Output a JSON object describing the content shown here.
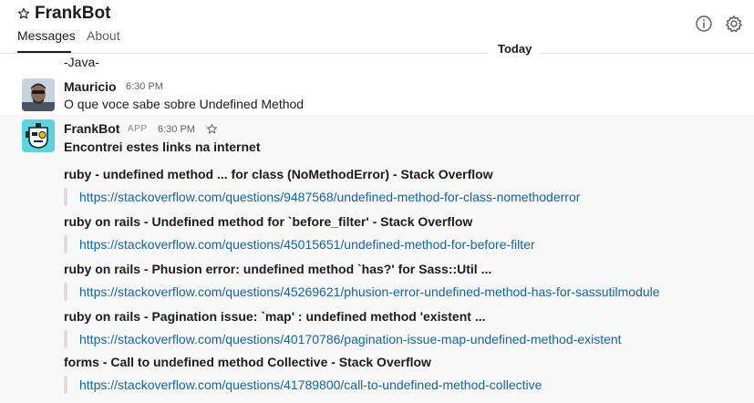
{
  "header": {
    "channel_name": "FrankBot",
    "tabs": [
      {
        "label": "Messages",
        "active": true
      },
      {
        "label": "About",
        "active": false
      }
    ],
    "icons": [
      "star-icon",
      "info-icon",
      "gear-icon"
    ]
  },
  "day_divider": "Today",
  "previous_message_tail": "-Java-",
  "messages": [
    {
      "author": "Mauricio",
      "time": "6:30 PM",
      "text": "O que voce sabe sobre Undefined Method"
    },
    {
      "author": "FrankBot",
      "badge": "APP",
      "time": "6:30 PM",
      "text": "Encontrei estes links na internet",
      "results": [
        {
          "title": "ruby - undefined method ... for class (NoMethodError) - Stack Overflow",
          "url": "https://stackoverflow.com/questions/9487568/undefined-method-for-class-nomethoderror"
        },
        {
          "title": "ruby on rails - Undefined method for `before_filter' - Stack Overflow",
          "url": "https://stackoverflow.com/questions/45015651/undefined-method-for-before-filter"
        },
        {
          "title": "ruby on rails - Phusion error: undefined method `has?' for Sass::Util ...",
          "url": "https://stackoverflow.com/questions/45269621/phusion-error-undefined-method-has-for-sassutilmodule"
        },
        {
          "title": "ruby on rails - Pagination issue: `map' : undefined method 'existent ...",
          "url": "https://stackoverflow.com/questions/40170786/pagination-issue-map-undefined-method-existent"
        },
        {
          "title": "forms - Call to undefined method Collective - Stack Overflow",
          "url": "https://stackoverflow.com/questions/41789800/call-to-undefined-method-collective"
        }
      ]
    }
  ],
  "colors": {
    "link": "#1264a3",
    "text": "#1d1c1d",
    "muted": "#616061",
    "bot_message_bg": "#f8f8f8",
    "bot_avatar_bg": "#5ed3e0"
  }
}
